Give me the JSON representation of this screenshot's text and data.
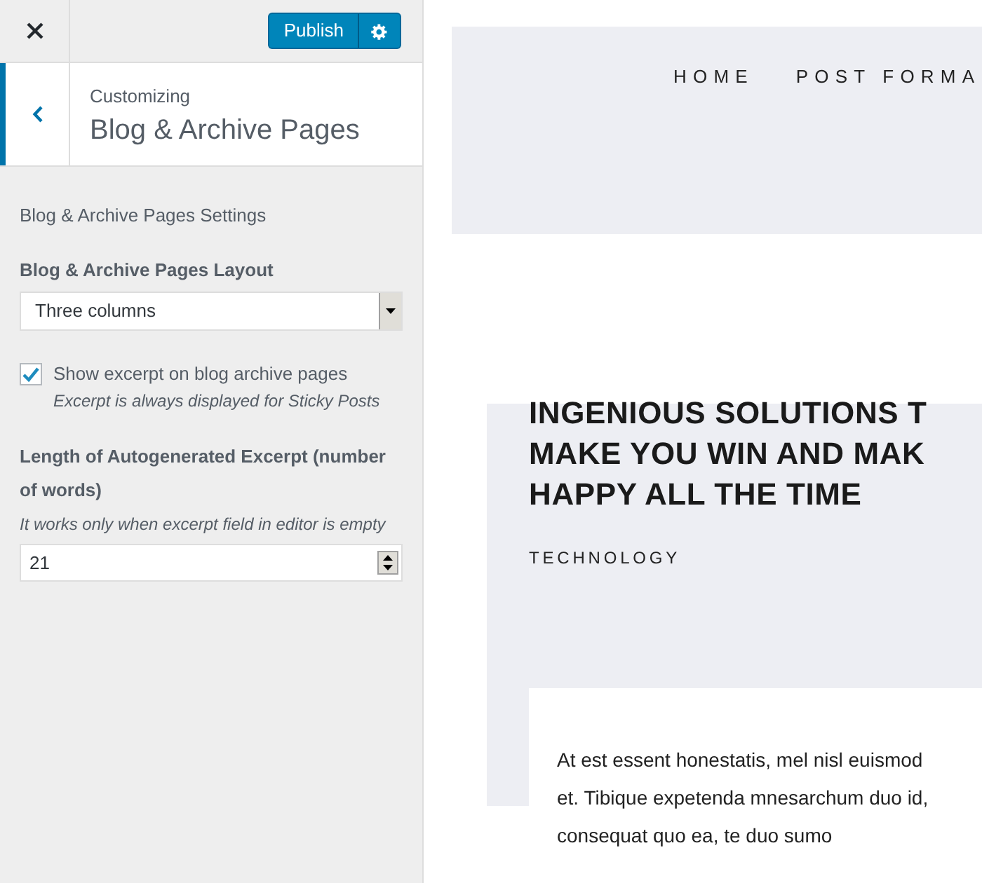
{
  "header": {
    "publish_label": "Publish"
  },
  "section": {
    "breadcrumb": "Customizing",
    "title": "Blog & Archive Pages"
  },
  "settings": {
    "heading": "Blog & Archive Pages Settings",
    "layout": {
      "label": "Blog & Archive Pages Layout",
      "value": "Three columns"
    },
    "excerpt_toggle": {
      "label": "Show excerpt on blog archive pages",
      "description": "Excerpt is always displayed for Sticky Posts",
      "checked": true
    },
    "excerpt_length": {
      "label": "Length of Autogenerated Excerpt (number of words)",
      "description": "It works only when excerpt field in editor is empty",
      "value": "21"
    }
  },
  "preview": {
    "nav": [
      "HOME",
      "POST FORMA"
    ],
    "post": {
      "title_lines": [
        "INGENIOUS SOLUTIONS T",
        "MAKE YOU WIN AND MAK",
        "HAPPY ALL THE TIME"
      ],
      "category": "TECHNOLOGY",
      "excerpt_lines": [
        "At est essent honestatis, mel nisl euismod",
        "et. Tibique expetenda mnesarchum duo id,",
        "consequat quo ea, te duo sumo"
      ]
    }
  }
}
